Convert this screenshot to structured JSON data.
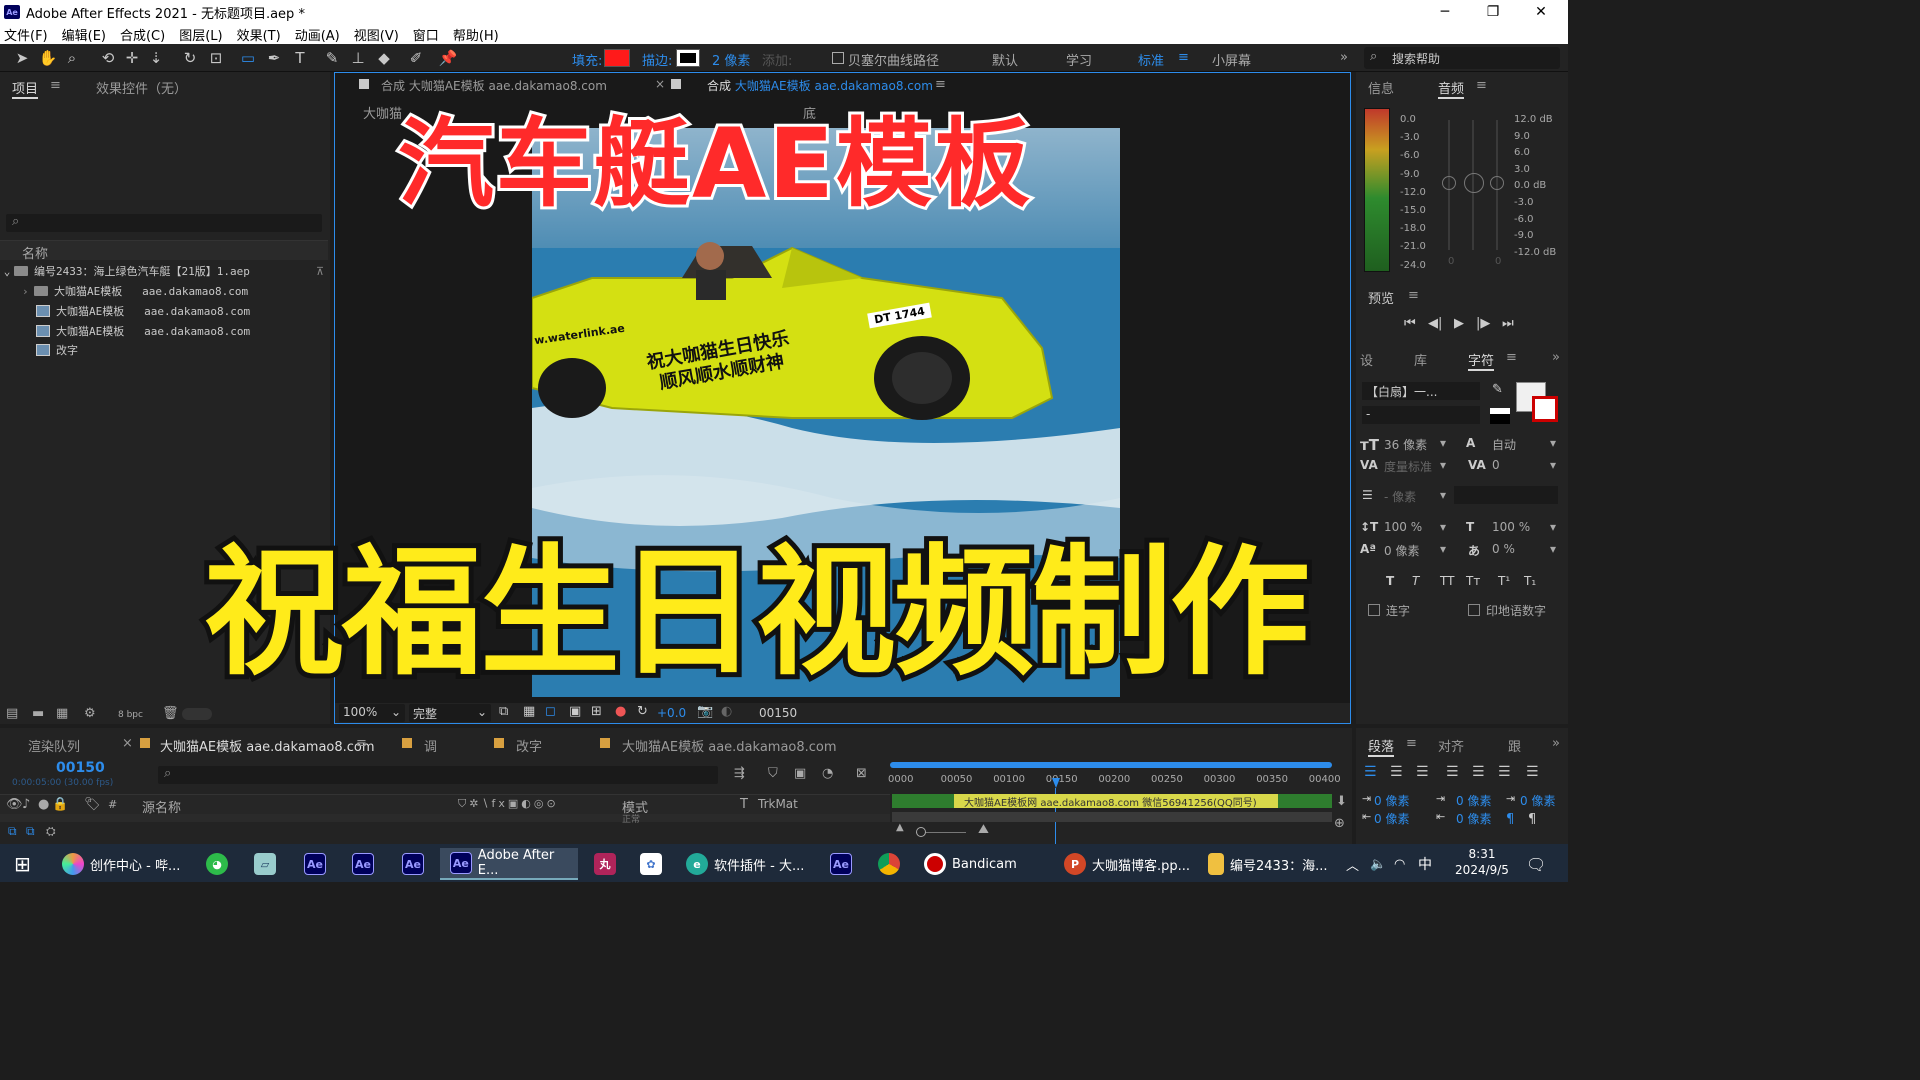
{
  "window": {
    "title": "Adobe After Effects 2021 - 无标题项目.aep *",
    "app_icon": "Ae",
    "controls": [
      "─",
      "❐",
      "✕"
    ]
  },
  "menu": [
    "文件(F)",
    "编辑(E)",
    "合成(C)",
    "图层(L)",
    "效果(T)",
    "动画(A)",
    "视图(V)",
    "窗口",
    "帮助(H)"
  ],
  "toolbar": {
    "fill_label": "填充:",
    "fill_color": "#ff1a1a",
    "stroke_label": "描边:",
    "stroke_size": "2 像素",
    "add_label": "添加:",
    "bezier_label": "贝塞尔曲线路径",
    "workspaces": [
      "默认",
      "学习",
      "标准",
      "小屏幕"
    ],
    "active_workspace": "标准",
    "search_placeholder": "搜索帮助"
  },
  "project_panel": {
    "tabs": [
      "项目",
      "效果控件（无）"
    ],
    "column_name": "名称",
    "root": "编号2433：海上绿色汽车艇【21版】1.aep",
    "items": [
      {
        "name": "大咖猫AE模板",
        "sub": "aae.dakamao8.com",
        "type": "folder"
      },
      {
        "name": "大咖猫AE模板",
        "sub": "aae.dakamao8.com",
        "type": "comp"
      },
      {
        "name": "大咖猫AE模板",
        "sub": "aae.dakamao8.com",
        "type": "comp"
      },
      {
        "name": "改字",
        "sub": "",
        "type": "comp"
      }
    ],
    "bpc": "8 bpc"
  },
  "viewer": {
    "tabs": [
      {
        "prefix": "合成",
        "name": "大咖猫AE模板",
        "url": "aae.dakamao8.com"
      },
      {
        "prefix": "合成",
        "name": "大咖猫AE模板",
        "url": "aae.dakamao8.com"
      }
    ],
    "breadcrumb_1": "大咖猫",
    "breadcrumb_2": "底",
    "zoom": "100%",
    "quality": "完整",
    "exposure": "+0.0",
    "timecode": "00150",
    "headline_top": "汽车艇AE模板",
    "headline_bottom": "祝福生日视频制作",
    "boat_text_line1": "祝大咖猫生日快乐",
    "boat_text_line2": "顺风顺水顺财神",
    "boat_plate": "DT 1744",
    "boat_site": "w.waterlink.ae"
  },
  "info_panel": {
    "tabs": [
      "信息",
      "音频"
    ],
    "left_scale": [
      "0.0",
      "-3.0",
      "-6.0",
      "-9.0",
      "-12.0",
      "-15.0",
      "-18.0",
      "-21.0",
      "-24.0"
    ],
    "right_scale": [
      "12.0 dB",
      "9.0",
      "6.0",
      "3.0",
      "0.0 dB",
      "-3.0",
      "-6.0",
      "-9.0",
      "-12.0 dB"
    ],
    "meter_bottom": [
      "0",
      "0"
    ]
  },
  "preview_panel": {
    "title": "预览",
    "buttons": [
      "⏮",
      "◀|",
      "▶",
      "|▶",
      "⏭"
    ]
  },
  "character_panel": {
    "tabs": [
      "设",
      "库",
      "字符"
    ],
    "font": "【白扇】一...",
    "style": "-",
    "size": "36 像素",
    "leading": "自动",
    "kerning": "度量标准",
    "tracking": "0",
    "stroke_width": "- 像素",
    "vscale": "100 %",
    "hscale": "100 %",
    "baseline": "0 像素",
    "tsume": "0 %",
    "styles": [
      "T",
      "T",
      "TT",
      "Tт",
      "T¹",
      "T₁"
    ],
    "ligature": "连字",
    "hindi": "印地语数字"
  },
  "paragraph_panel": {
    "tabs": [
      "段落",
      "对齐",
      "跟"
    ],
    "indent_values": [
      "0 像素",
      "0 像素",
      "0 像素",
      "0 像素",
      "0 像素"
    ]
  },
  "timeline": {
    "tabs": [
      "渲染队列",
      "大咖猫AE模板 aae.dakamao8.com",
      "调",
      "改字",
      "大咖猫AE模板 aae.dakamao8.com"
    ],
    "timecode": "00150",
    "fps": "0:00:05:00 (30.00 fps)",
    "columns": [
      "源名称",
      "模式",
      "T",
      "TrkMat"
    ],
    "ruler": [
      "0000",
      "00050",
      "00100",
      "00150",
      "00200",
      "00250",
      "00300",
      "00350",
      "00400"
    ],
    "layer_bar": "大咖猫AE模板网  aae.dakamao8.com  微信56941256(QQ同号)",
    "mode_value": "正常"
  },
  "taskbar": {
    "items": [
      "创作中心 - 哔...",
      "Adobe After E...",
      "软件插件 - 大...",
      "Bandicam",
      "大咖猫博客.pp...",
      "编号2433：海..."
    ],
    "ae_icon": "Ae",
    "time": "8:31",
    "date": "2024/9/5",
    "ime": "中"
  }
}
